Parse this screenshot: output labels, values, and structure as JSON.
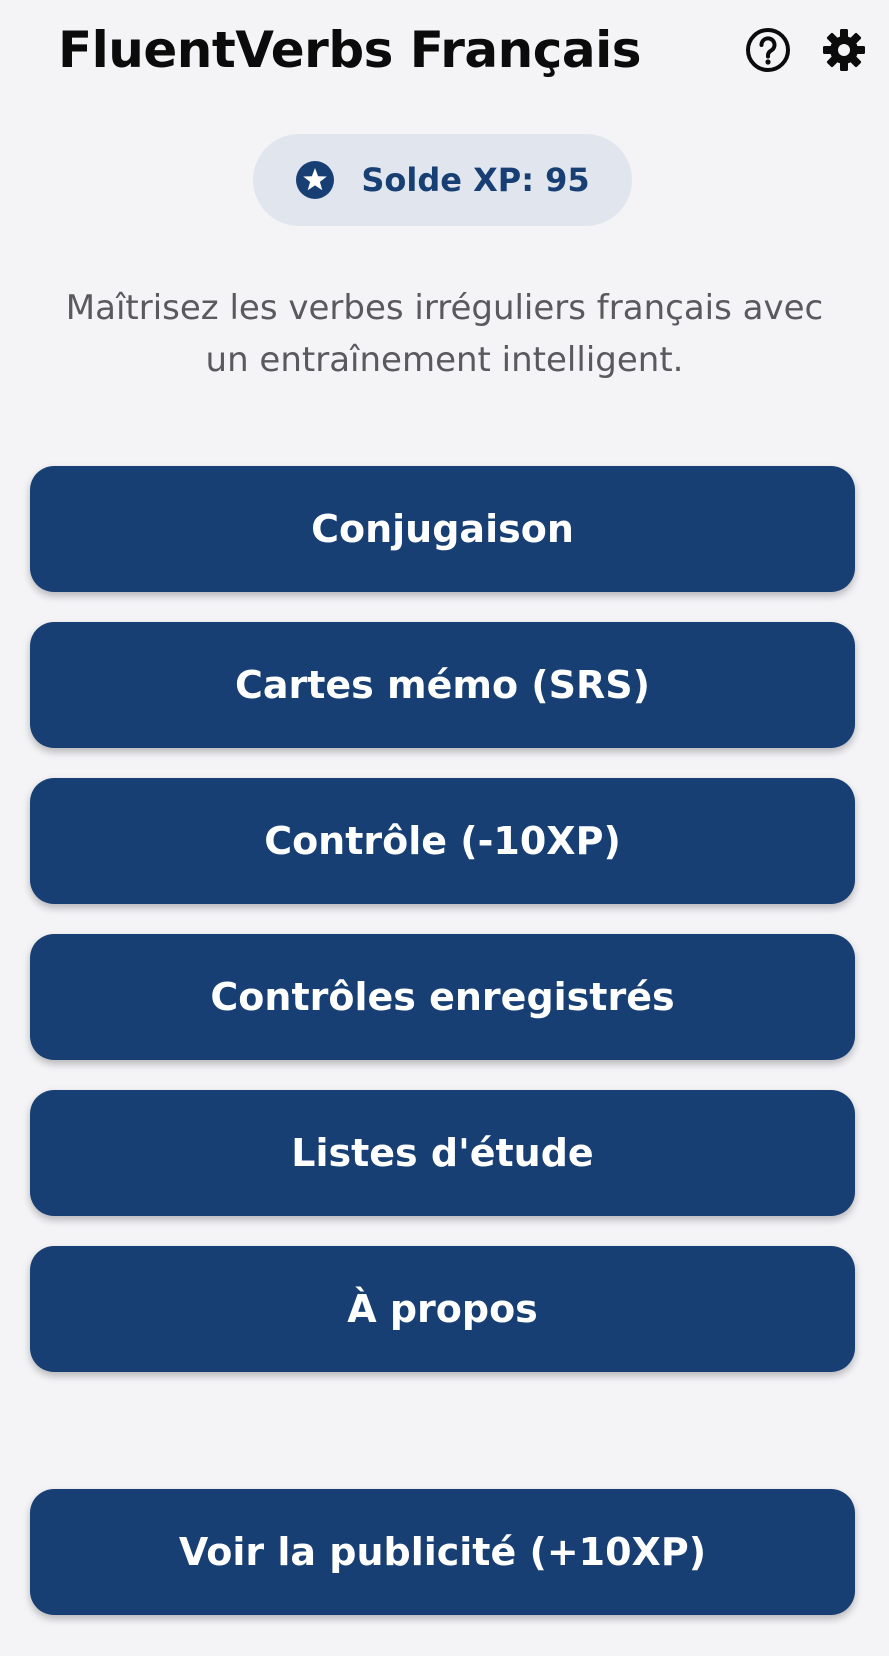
{
  "header": {
    "title": "FluentVerbs Français",
    "help_icon": "help-circle-icon",
    "settings_icon": "gear-icon"
  },
  "xp": {
    "icon": "star-badge-icon",
    "label": "Solde XP: 95"
  },
  "tagline": "Maîtrisez les verbes irréguliers français avec un entraînement intelligent.",
  "menu": {
    "conjugation": "Conjugaison",
    "flashcards": "Cartes mémo (SRS)",
    "quiz": "Contrôle (-10XP)",
    "saved_quizzes": "Contrôles enregistrés",
    "study_lists": "Listes d'étude",
    "about": "À propos",
    "watch_ad": "Voir la publicité (+10XP)"
  },
  "colors": {
    "primary": "#173f74",
    "background": "#f4f4f7",
    "pill_background": "#e1e5ee",
    "title_text": "#0b0b0b",
    "body_text": "#5a5a5e"
  }
}
